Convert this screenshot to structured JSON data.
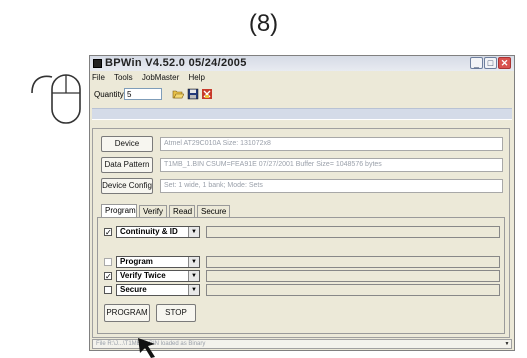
{
  "step_label": "(8)",
  "window": {
    "title": "BPWin  V4.52.0  05/24/2005",
    "minimize": "_",
    "maximize": "□",
    "close": "✕"
  },
  "menu": [
    "File",
    "Tools",
    "JobMaster",
    "Help"
  ],
  "toolbar": {
    "quantity_label": "Quantity:",
    "quantity_value": "5"
  },
  "rows": [
    {
      "button": "Device",
      "info": "Atmel AT29C010A  Size: 131072x8"
    },
    {
      "button": "Data Pattern",
      "info": "T1MB_1.BIN  CSUM=FEA91E  07/27/2001  Buffer Size= 1048576 bytes"
    },
    {
      "button": "Device Config",
      "info": "Set: 1 wide, 1 bank;  Mode: Sets"
    }
  ],
  "tabs": [
    "Program",
    "Verify",
    "Read",
    "Secure"
  ],
  "operations": [
    {
      "checked": true,
      "label": "Continuity & ID"
    },
    {
      "checked": false,
      "label": "Program"
    },
    {
      "checked": true,
      "label": "Verify Twice"
    },
    {
      "checked": false,
      "label": "Secure"
    }
  ],
  "actions": {
    "program": "PROGRAM",
    "stop": "STOP"
  },
  "status_text": "File R:\\J...\\T1MB_1.BIN loaded as Binary"
}
